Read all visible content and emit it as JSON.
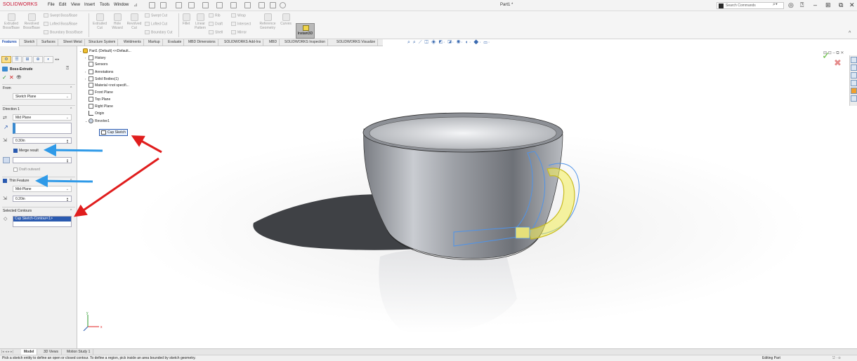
{
  "app": {
    "logo_brand": "SOLID",
    "logo_suffix": "WORKS",
    "document_title": "Part1 *",
    "search_placeholder": "Search Commands"
  },
  "menu": [
    "File",
    "Edit",
    "View",
    "Insert",
    "Tools",
    "Window"
  ],
  "ribbon": {
    "big": [
      {
        "label1": "Extruded",
        "label2": "Boss/Base"
      },
      {
        "label1": "Revolved",
        "label2": "Boss/Base"
      },
      {
        "label1": "Extruded",
        "label2": "Cut"
      },
      {
        "label1": "Hole",
        "label2": "Wizard"
      },
      {
        "label1": "Revolved",
        "label2": "Cut"
      },
      {
        "label1": "Fillet",
        "label2": ""
      },
      {
        "label1": "Linear",
        "label2": "Pattern"
      },
      {
        "label1": "Reference",
        "label2": "Geometry"
      },
      {
        "label1": "Curves",
        "label2": ""
      }
    ],
    "small": [
      "Swept Boss/Base",
      "Lofted Boss/Base",
      "Boundary Boss/Base",
      "Swept Cut",
      "Lofted Cut",
      "Boundary Cut",
      "Rib",
      "Draft",
      "Shell",
      "Wrap",
      "Intersect",
      "Mirror"
    ],
    "instant3d": "Instant3D"
  },
  "tabs": [
    "Features",
    "Sketch",
    "Surfaces",
    "Sheet Metal",
    "Structure System",
    "Weldments",
    "Markup",
    "Evaluate",
    "MBD Dimensions",
    "SOLIDWORKS Add-Ins",
    "MBD",
    "SOLIDWORKS Inspection",
    "SOLIDWORKS Visualize"
  ],
  "property_manager": {
    "title": "Boss-Extrude",
    "from_label": "From",
    "from_value": "Sketch Plane",
    "direction1_label": "Direction 1",
    "direction1_value": "Mid Plane",
    "depth1": "0.30in",
    "merge_result": "Merge result",
    "draft_outward": "Draft outward",
    "thin_feature": "Thin Feature",
    "thin_type": "Mid-Plane",
    "thin_thickness": "0.20in",
    "selected_contours_label": "Selected Contours",
    "selected_contour": "Cup Sketch-Contour<1>"
  },
  "tree": {
    "root": "Part1 (Default) <<Default...",
    "items": [
      "History",
      "Sensors",
      "Annotations",
      "Solid Bodies(1)",
      "Material <not specifi...",
      "Front Plane",
      "Top Plane",
      "Right Plane",
      "Origin",
      "Revolve1"
    ],
    "child": "Cup Sketch"
  },
  "bottom_tabs": [
    "Model",
    "3D Views",
    "Motion Study 1"
  ],
  "status": {
    "message": "Pick a sketch entity to define an open or closed contour. To define a region, pick inside an area bounded by sketch geometry.",
    "mode": "Editing Part"
  },
  "colors": {
    "arrow_red": "#e01d1d",
    "arrow_blue": "#2f9ae8",
    "selection_yellow": "#f4ee58",
    "sketch_blue": "#4f93e8",
    "accent": "#1a4ab0"
  }
}
